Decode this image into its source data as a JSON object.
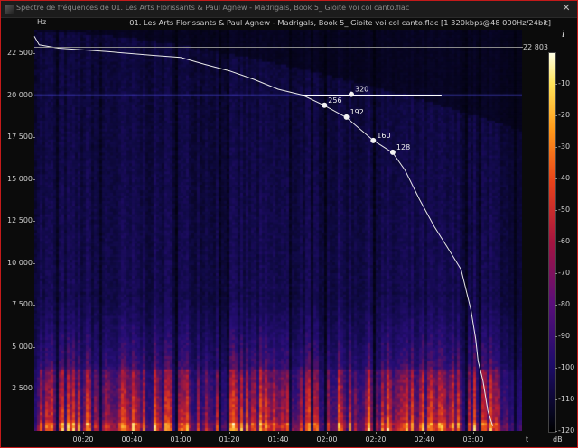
{
  "window": {
    "title": "Spectre de fréquences de 01. Les Arts Florissants & Paul Agnew - Madrigals, Book 5_ Gioite voi col canto.flac",
    "close_glyph": "✕"
  },
  "file_info": "01. Les Arts Florissants & Paul Agnew - Madrigals, Book 5_ Gioite voi col canto.flac [1 320kbps@48 000Hz/24bit]",
  "icons": {
    "info": "i",
    "app": "spectrum-icon"
  },
  "colors": {
    "border": "#c41a1a",
    "curve": "#e8e8e8"
  },
  "chart_data": {
    "type": "heatmap",
    "y_unit": "Hz",
    "x_unit": "t",
    "colorbar_unit": "dB",
    "y_ticks": [
      "22 500",
      "20 000",
      "17 500",
      "15 000",
      "12 500",
      "10 000",
      "7 500",
      "5 000",
      "2 500"
    ],
    "y_tick_values": [
      22500,
      20000,
      17500,
      15000,
      12500,
      10000,
      7500,
      5000,
      2500
    ],
    "ylim": [
      0,
      23900
    ],
    "x_ticks": [
      "00:20",
      "00:40",
      "01:00",
      "01:20",
      "01:40",
      "02:00",
      "02:20",
      "02:40",
      "03:00"
    ],
    "x_tick_values": [
      20,
      40,
      60,
      80,
      100,
      120,
      140,
      160,
      180
    ],
    "xlim": [
      0,
      200
    ],
    "max_frequency_label": "22 803",
    "max_frequency": 22803,
    "colorbar_ticks": [
      "-10",
      "-20",
      "-30",
      "-40",
      "-50",
      "-60",
      "-70",
      "-80",
      "-90",
      "-100",
      "-110",
      "-120"
    ],
    "colorbar_values": [
      -10,
      -20,
      -30,
      -40,
      -50,
      -60,
      -70,
      -80,
      -90,
      -100,
      -110,
      -120
    ],
    "colorbar_range": [
      -120,
      0
    ],
    "cutoff_markers": [
      {
        "label": "320",
        "t": 130,
        "hz": 20050
      },
      {
        "label": "256",
        "t": 119,
        "hz": 19400
      },
      {
        "label": "192",
        "t": 128,
        "hz": 18700
      },
      {
        "label": "160",
        "t": 139,
        "hz": 17300
      },
      {
        "label": "128",
        "t": 147,
        "hz": 16600
      }
    ]
  }
}
